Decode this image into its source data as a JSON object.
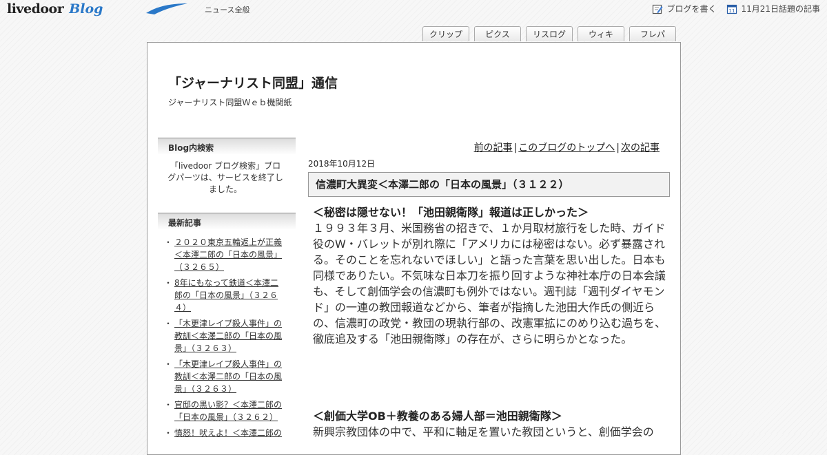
{
  "header": {
    "logo_text": "livedoor",
    "logo_blog": "Blog",
    "category": "ニュース全般",
    "write_blog": "ブログを書く",
    "topics": "11月21日話題の記事"
  },
  "tabs": [
    "クリップ",
    "ピクス",
    "リスログ",
    "ウィキ",
    "フレパ"
  ],
  "blog": {
    "title": "「ジャーナリスト同盟」通信",
    "description": "ジャーナリスト同盟Ｗｅｂ機関紙"
  },
  "sidebar": {
    "search_heading": "Blog内検索",
    "search_notice": "「livedoor ブログ検索」ブログパーツは、サービスを終了しました。",
    "recent_heading": "最新記事",
    "recent_items": [
      "２０２０東京五輪返上が正義＜本澤二郎の「日本の風景」（３２６５）",
      "8年にもなって鉄道＜本澤二郎の「日本の風景」（３２６４）",
      "「木更津レイプ殺人事件」の教訓＜本澤二郎の「日本の風景」（３２６３）",
      "「木更津レイプ殺人事件」の教訓＜本澤二郎の「日本の風景」（３２６３）",
      "官邸の黒い影？＜本澤二郎の「日本の風景」（３２６２）",
      "憤怒！吠えよ！＜本澤二郎の"
    ]
  },
  "entry_nav": {
    "prev": "前の記事",
    "top": "このブログのトップへ",
    "next": "次の記事",
    "separator": "|"
  },
  "entry": {
    "date": "2018年10月12日",
    "title": "信濃町大異変＜本澤二郎の「日本の風景」（３１２２）",
    "heading1": "＜秘密は隠せない！「池田親衛隊」報道は正しかった＞",
    "paragraph1": "１９９３年３月、米国務省の招きで、１か月取材旅行をした時、ガイド役のW・バレットが別れ際に「アメリカには秘密はない。必ず暴露される。そのことを忘れないでほしい」と語った言葉を思い出した。日本も同様でありたい。不気味な日本刀を振り回すような神社本庁の日本会議も、そして創価学会の信濃町も例外ではない。週刊誌「週刊ダイヤモンド」の一連の教団報道などから、筆者が指摘した池田大作氏の側近らの、信濃町の政党・教団の現執行部の、改憲軍拡にのめり込む過ちを、徹底追及する「池田親衛隊」の存在が、さらに明らかとなった。",
    "heading2": "＜創価大学OB＋教養のある婦人部＝池田親衛隊＞",
    "paragraph2": "新興宗教団体の中で、平和に軸足を置いた教団というと、創価学会の"
  },
  "colors": {
    "logo_blue": "#2a78c8",
    "title_box_bg": "#f2f2f2"
  }
}
